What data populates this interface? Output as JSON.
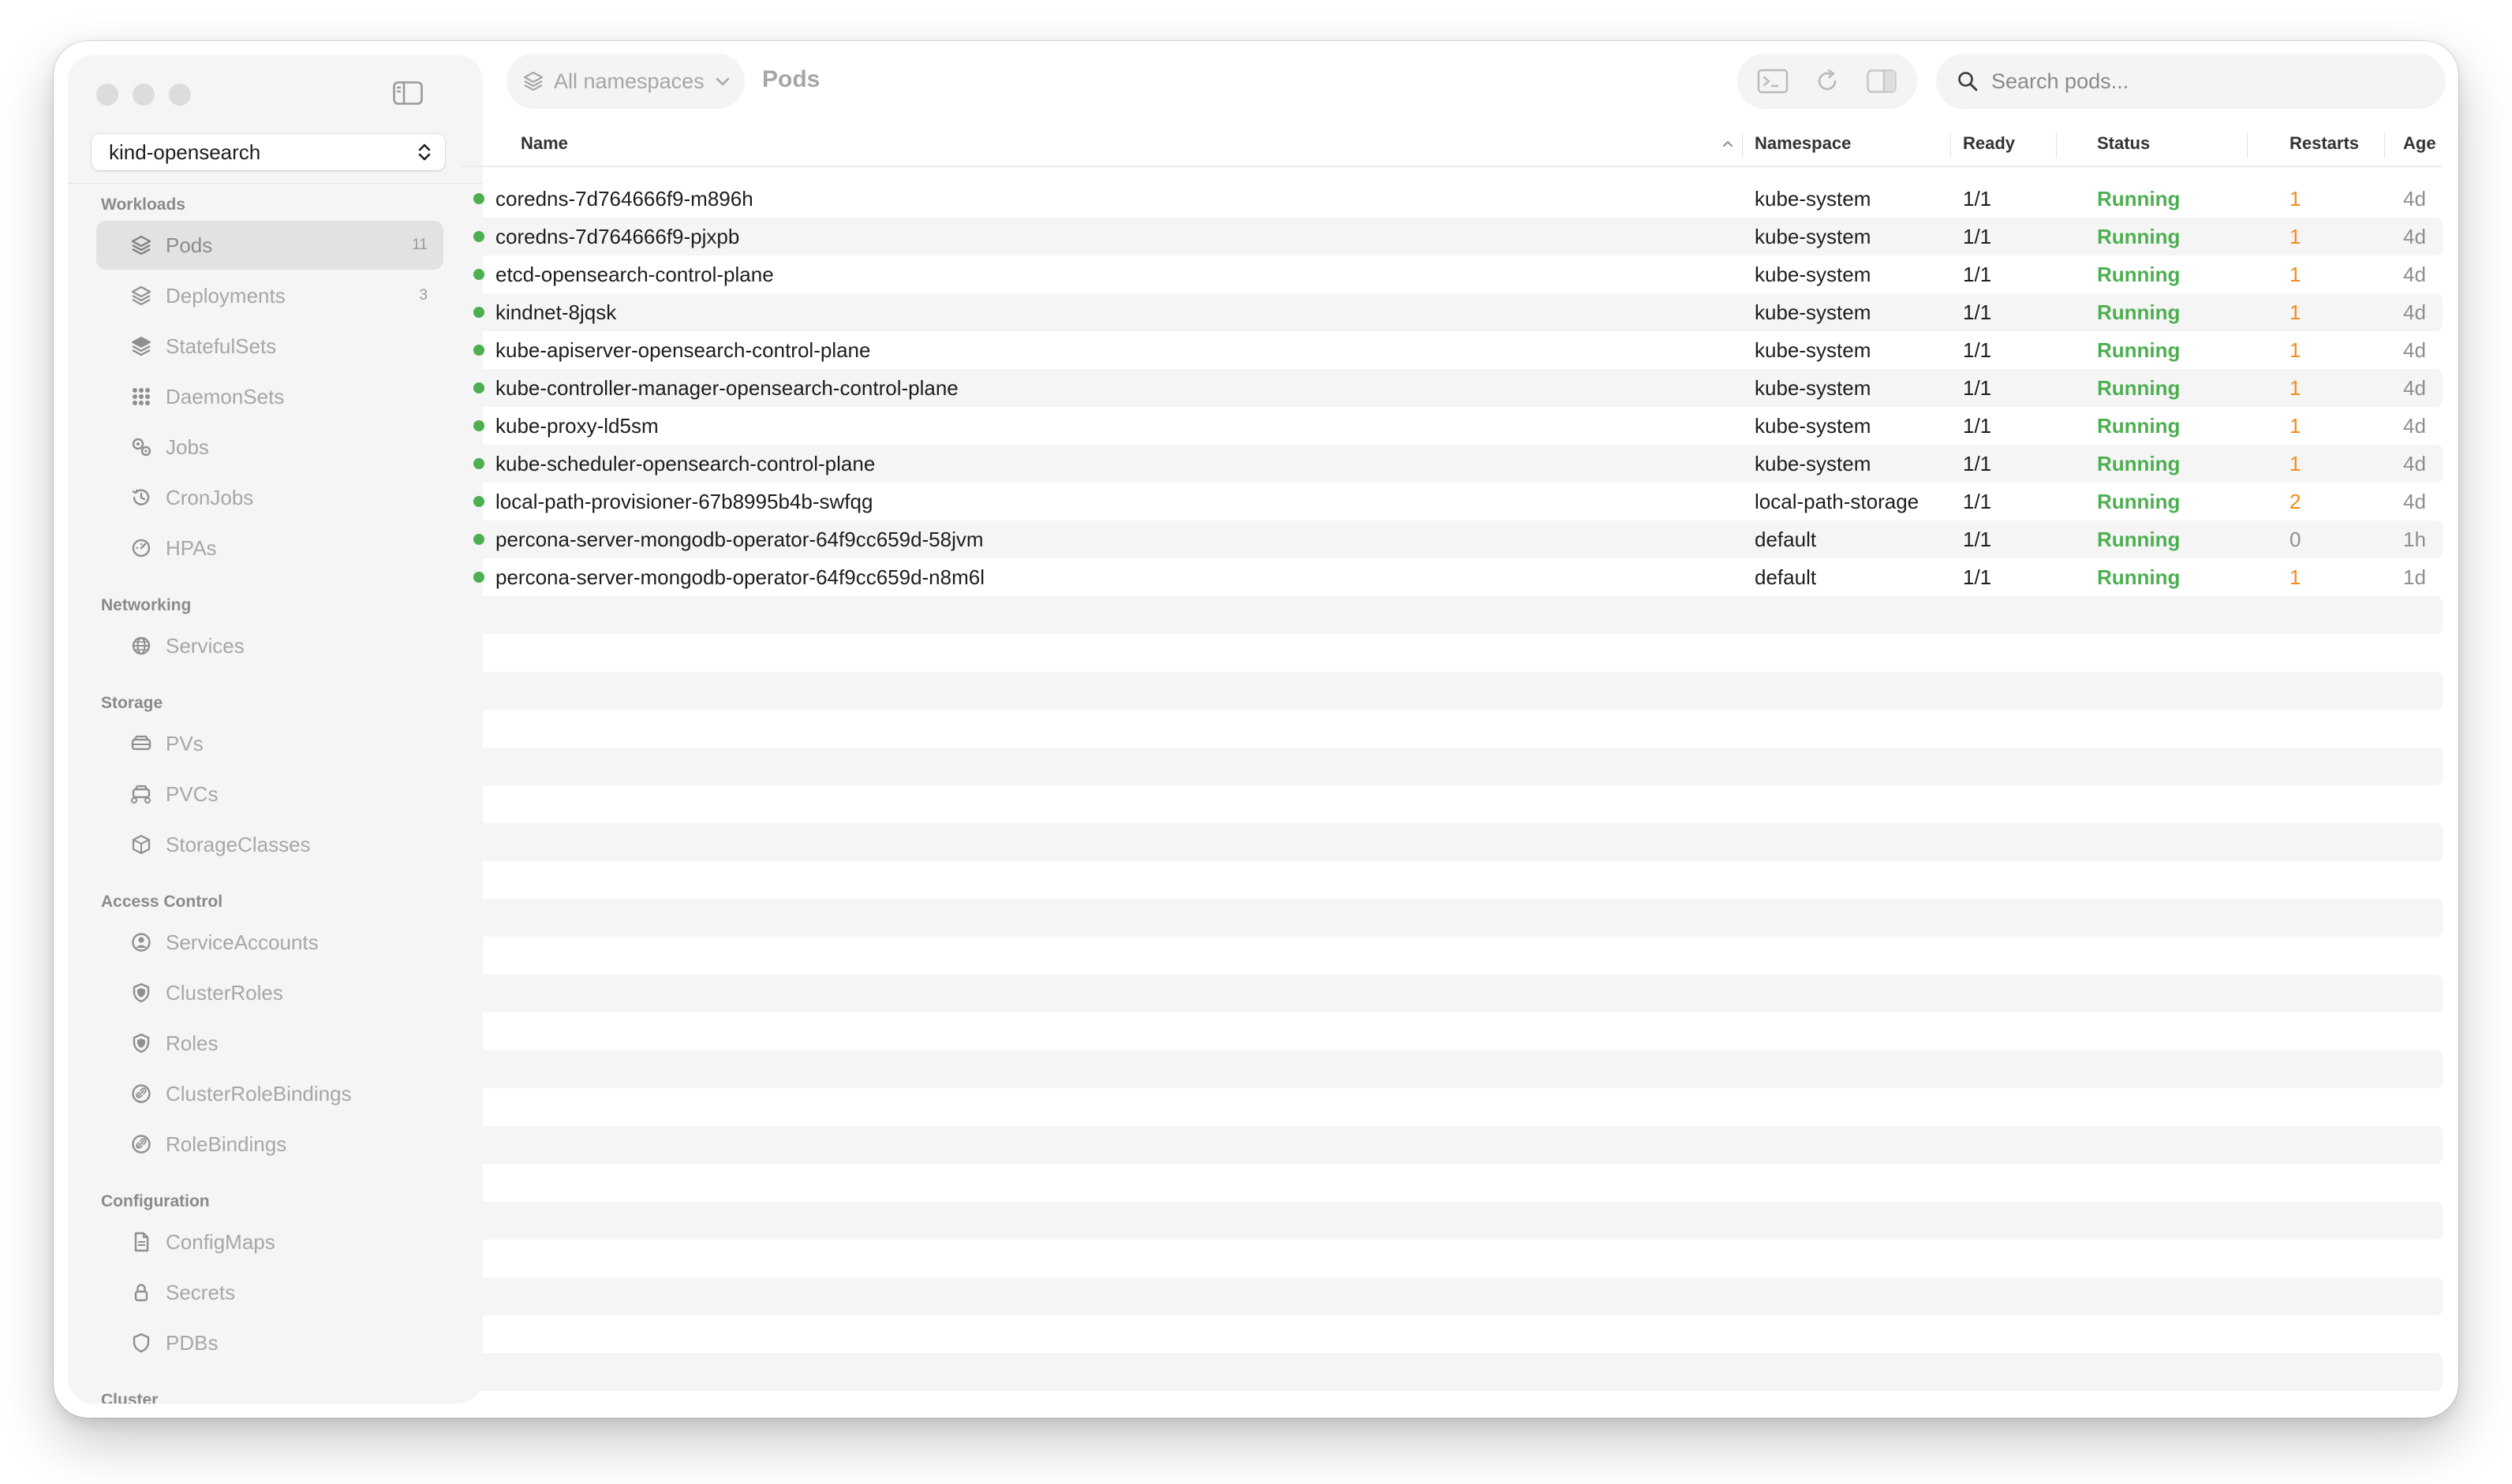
{
  "sidebar": {
    "context": "kind-opensearch",
    "sections": [
      {
        "title": "Workloads",
        "items": [
          {
            "label": "Pods",
            "count": "11",
            "icon": "layers-icon",
            "active": true
          },
          {
            "label": "Deployments",
            "count": "3",
            "icon": "stack-icon"
          },
          {
            "label": "StatefulSets",
            "count": "",
            "icon": "stack-filled-icon"
          },
          {
            "label": "DaemonSets",
            "count": "",
            "icon": "grid-dots-icon"
          },
          {
            "label": "Jobs",
            "count": "",
            "icon": "gears-icon"
          },
          {
            "label": "CronJobs",
            "count": "",
            "icon": "history-clock-icon"
          },
          {
            "label": "HPAs",
            "count": "",
            "icon": "gauge-icon"
          }
        ]
      },
      {
        "title": "Networking",
        "items": [
          {
            "label": "Services",
            "count": "",
            "icon": "globe-icon"
          }
        ]
      },
      {
        "title": "Storage",
        "items": [
          {
            "label": "PVs",
            "count": "",
            "icon": "drive-icon"
          },
          {
            "label": "PVCs",
            "count": "",
            "icon": "drive-link-icon"
          },
          {
            "label": "StorageClasses",
            "count": "",
            "icon": "cube-icon"
          }
        ]
      },
      {
        "title": "Access Control",
        "items": [
          {
            "label": "ServiceAccounts",
            "count": "",
            "icon": "person-circle-icon"
          },
          {
            "label": "ClusterRoles",
            "count": "",
            "icon": "shield-icon"
          },
          {
            "label": "Roles",
            "count": "",
            "icon": "shield-icon"
          },
          {
            "label": "ClusterRoleBindings",
            "count": "",
            "icon": "link-circle-icon"
          },
          {
            "label": "RoleBindings",
            "count": "",
            "icon": "link-circle-icon"
          }
        ]
      },
      {
        "title": "Configuration",
        "items": [
          {
            "label": "ConfigMaps",
            "count": "",
            "icon": "document-icon"
          },
          {
            "label": "Secrets",
            "count": "",
            "icon": "lock-icon"
          },
          {
            "label": "PDBs",
            "count": "",
            "icon": "shield-outline-icon"
          }
        ]
      },
      {
        "title": "Cluster",
        "items": []
      }
    ]
  },
  "toolbar": {
    "namespace_label": "All namespaces",
    "page_title": "Pods",
    "search_placeholder": "Search pods..."
  },
  "table": {
    "columns": [
      "Name",
      "Namespace",
      "Ready",
      "Status",
      "Restarts",
      "Age"
    ],
    "rows": [
      {
        "name": "coredns-7d764666f9-m896h",
        "namespace": "kube-system",
        "ready": "1/1",
        "status": "Running",
        "restarts": "1",
        "age": "4d"
      },
      {
        "name": "coredns-7d764666f9-pjxpb",
        "namespace": "kube-system",
        "ready": "1/1",
        "status": "Running",
        "restarts": "1",
        "age": "4d"
      },
      {
        "name": "etcd-opensearch-control-plane",
        "namespace": "kube-system",
        "ready": "1/1",
        "status": "Running",
        "restarts": "1",
        "age": "4d"
      },
      {
        "name": "kindnet-8jqsk",
        "namespace": "kube-system",
        "ready": "1/1",
        "status": "Running",
        "restarts": "1",
        "age": "4d"
      },
      {
        "name": "kube-apiserver-opensearch-control-plane",
        "namespace": "kube-system",
        "ready": "1/1",
        "status": "Running",
        "restarts": "1",
        "age": "4d"
      },
      {
        "name": "kube-controller-manager-opensearch-control-plane",
        "namespace": "kube-system",
        "ready": "1/1",
        "status": "Running",
        "restarts": "1",
        "age": "4d"
      },
      {
        "name": "kube-proxy-ld5sm",
        "namespace": "kube-system",
        "ready": "1/1",
        "status": "Running",
        "restarts": "1",
        "age": "4d"
      },
      {
        "name": "kube-scheduler-opensearch-control-plane",
        "namespace": "kube-system",
        "ready": "1/1",
        "status": "Running",
        "restarts": "1",
        "age": "4d"
      },
      {
        "name": "local-path-provisioner-67b8995b4b-swfqg",
        "namespace": "local-path-storage",
        "ready": "1/1",
        "status": "Running",
        "restarts": "2",
        "age": "4d"
      },
      {
        "name": "percona-server-mongodb-operator-64f9cc659d-58jvm",
        "namespace": "default",
        "ready": "1/1",
        "status": "Running",
        "restarts": "0",
        "age": "1h"
      },
      {
        "name": "percona-server-mongodb-operator-64f9cc659d-n8m6l",
        "namespace": "default",
        "ready": "1/1",
        "status": "Running",
        "restarts": "1",
        "age": "1d"
      }
    ]
  },
  "colors": {
    "running": "#4caf50",
    "restart_warn": "#f28b1c",
    "restart_zero": "#8e8e93",
    "sidebar_bg": "#f5f5f5",
    "row_stripe": "#f5f5f5"
  }
}
